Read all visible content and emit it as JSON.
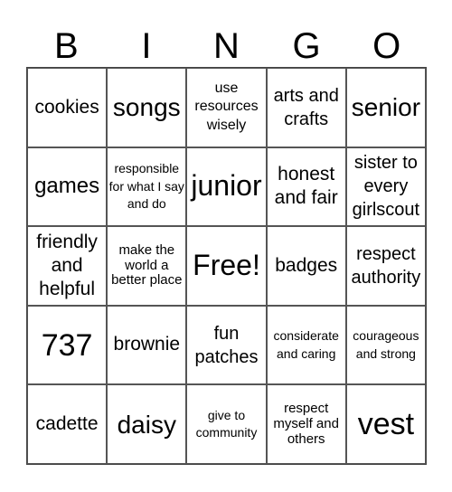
{
  "title_letters": [
    "B",
    "I",
    "N",
    "G",
    "O"
  ],
  "cells": [
    [
      "cookies",
      "songs",
      "use resources wisely",
      "arts and crafts",
      "senior"
    ],
    [
      "games",
      "responsible for what I say and do",
      "junior",
      "honest and fair",
      "sister to every girlscout"
    ],
    [
      "friendly and helpful",
      "make the world a better place",
      "Free!",
      "badges",
      "respect authority"
    ],
    [
      "737",
      "brownie",
      "fun patches",
      "considerate and caring",
      "courageous and strong"
    ],
    [
      "cadette",
      "daisy",
      "give to community",
      "respect myself and others",
      "vest"
    ]
  ]
}
